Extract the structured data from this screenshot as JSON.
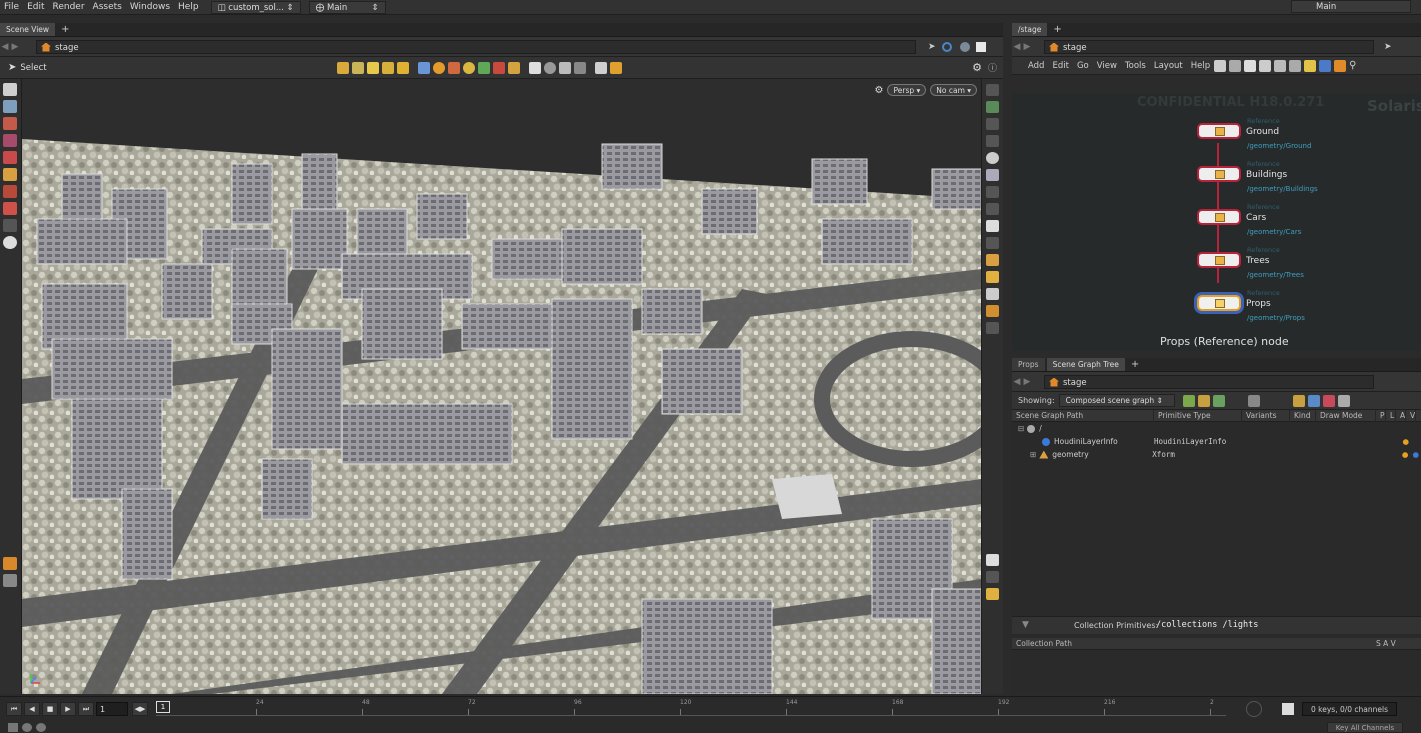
{
  "menu": [
    "File",
    "Edit",
    "Render",
    "Assets",
    "Windows",
    "Help"
  ],
  "desktop": {
    "file": "custom_sol...",
    "desk": "Main",
    "right_desk": "Main"
  },
  "scene_view": {
    "tab": "Scene View",
    "path": "stage",
    "tool": "Select",
    "camera_persp": "Persp ▾",
    "camera_nocam": "No cam ▾"
  },
  "network": {
    "tab": "/stage",
    "path": "stage",
    "menu": [
      "Add",
      "Edit",
      "Go",
      "View",
      "Tools",
      "Layout",
      "Help"
    ],
    "watermark": "CONFIDENTIAL H18.0.271",
    "context": "Solaris",
    "nodes": [
      {
        "type": "Reference",
        "name": "Ground",
        "path": "/geometry/Ground"
      },
      {
        "type": "Reference",
        "name": "Buildings",
        "path": "/geometry/Buildings"
      },
      {
        "type": "Reference",
        "name": "Cars",
        "path": "/geometry/Cars"
      },
      {
        "type": "Reference",
        "name": "Trees",
        "path": "/geometry/Trees"
      },
      {
        "type": "Reference",
        "name": "Props",
        "path": "/geometry/Props"
      }
    ],
    "caption": "Props (Reference) node"
  },
  "scene_graph": {
    "tabs": [
      "Props",
      "Scene Graph Tree"
    ],
    "path": "stage",
    "showing_label": "Showing:",
    "showing_value": "Composed scene graph",
    "columns": [
      "Scene Graph Path",
      "Primitive Type",
      "Variants",
      "Kind",
      "Draw Mode",
      "P",
      "L",
      "A",
      "V"
    ],
    "rows": [
      {
        "name": "/",
        "type": ""
      },
      {
        "name": "HoudiniLayerInfo",
        "type": "HoudiniLayerInfo"
      },
      {
        "name": "geometry",
        "type": "Xform"
      }
    ],
    "collection_label": "Collection Primitives:",
    "collection_value": "/collections /lights",
    "collection_path_header": "Collection Path",
    "collection_cols": "S A V"
  },
  "timeline": {
    "frame": "1",
    "current": "1",
    "ticks": [
      "24",
      "48",
      "72",
      "96",
      "120",
      "144",
      "168",
      "192",
      "216",
      "2"
    ],
    "keys": "0 keys, 0/0 channels",
    "key_all": "Key All Channels"
  },
  "colors": {
    "node_wire": "#b8223a",
    "node_path": "#3f9fbf",
    "accent": "#e1892a"
  }
}
